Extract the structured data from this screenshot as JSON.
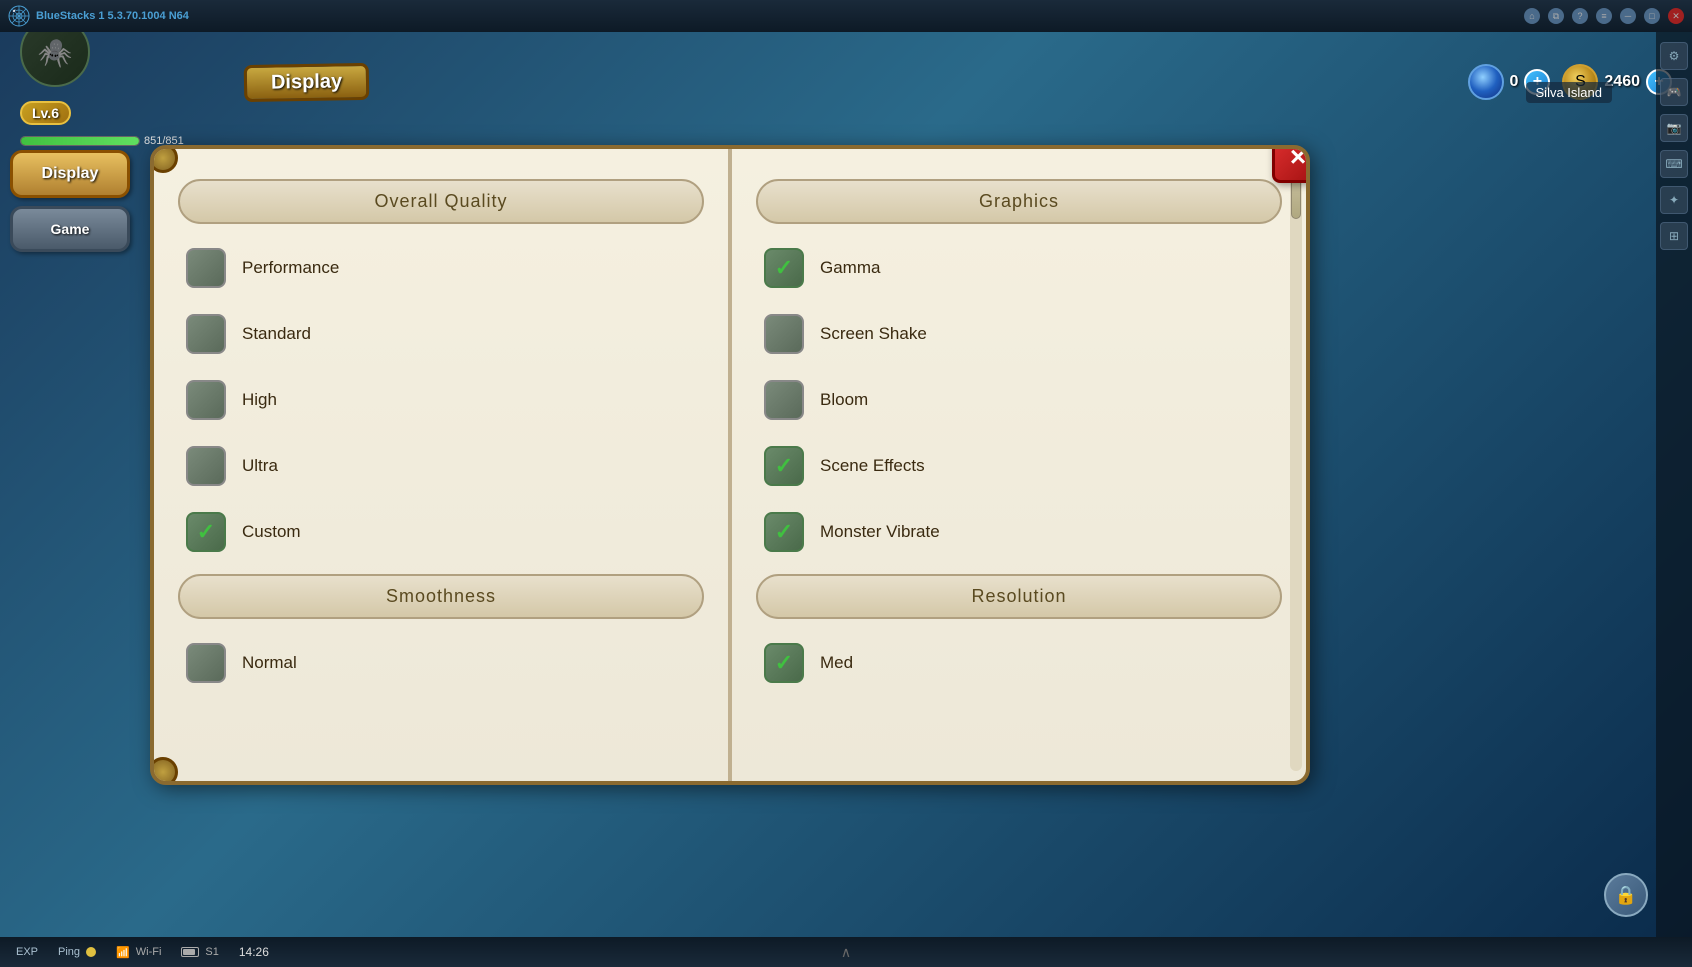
{
  "app": {
    "title": "BlueStacks 1",
    "version": "5.3.70.1004 N64"
  },
  "topbar": {
    "title": "BlueStacks 1 5.3.70.1004 N64"
  },
  "header": {
    "level": "Lv.6",
    "hp_current": "851",
    "hp_max": "851",
    "hp_display": "851/851",
    "display_title": "Display",
    "crystal_count": "0",
    "coin_count": "2460",
    "location": "Silva Island"
  },
  "nav": {
    "items": [
      {
        "id": "display",
        "label": "Display",
        "active": true
      },
      {
        "id": "game",
        "label": "Game",
        "active": false
      }
    ]
  },
  "dialog": {
    "left_panel": {
      "overall_quality": {
        "header": "Overall Quality",
        "options": [
          {
            "id": "performance",
            "label": "Performance",
            "checked": false
          },
          {
            "id": "standard",
            "label": "Standard",
            "checked": false
          },
          {
            "id": "high",
            "label": "High",
            "checked": false
          },
          {
            "id": "ultra",
            "label": "Ultra",
            "checked": false
          },
          {
            "id": "custom",
            "label": "Custom",
            "checked": true
          }
        ]
      },
      "smoothness": {
        "header": "Smoothness",
        "options": [
          {
            "id": "normal",
            "label": "Normal",
            "checked": false
          }
        ]
      }
    },
    "right_panel": {
      "graphics": {
        "header": "Graphics",
        "options": [
          {
            "id": "gamma",
            "label": "Gamma",
            "checked": true
          },
          {
            "id": "screen-shake",
            "label": "Screen Shake",
            "checked": false
          },
          {
            "id": "bloom",
            "label": "Bloom",
            "checked": false
          },
          {
            "id": "scene-effects",
            "label": "Scene Effects",
            "checked": true
          },
          {
            "id": "monster-vibrate",
            "label": "Monster Vibrate",
            "checked": true
          }
        ]
      },
      "resolution": {
        "header": "Resolution",
        "options": [
          {
            "id": "med",
            "label": "Med",
            "checked": true
          }
        ]
      }
    },
    "close_label": "×"
  },
  "bottombar": {
    "exp_label": "EXP",
    "ping_label": "Ping",
    "wifi_label": "Wi-Fi",
    "battery_label": "S1",
    "time": "14:26"
  }
}
